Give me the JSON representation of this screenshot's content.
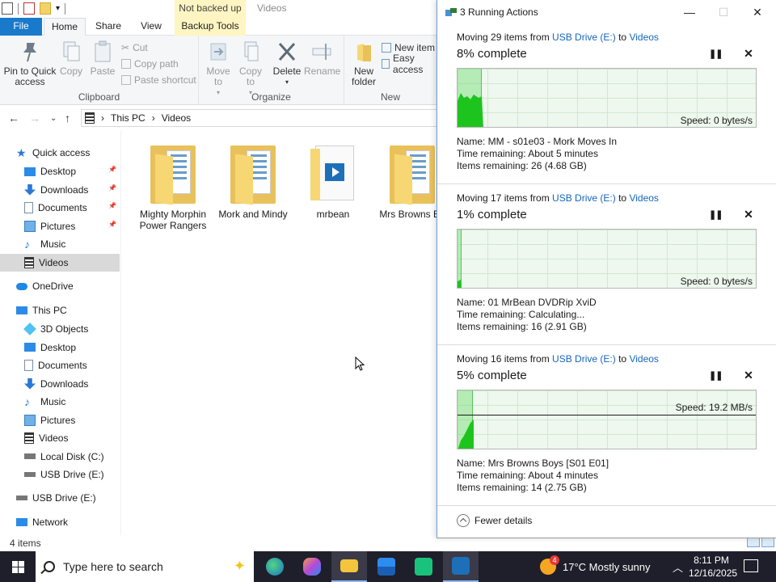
{
  "explorer": {
    "backup_context_header": "Not backed up",
    "folder_title": "Videos",
    "tabs": {
      "file": "File",
      "home": "Home",
      "share": "Share",
      "view": "View",
      "backup": "Backup Tools"
    },
    "ribbon": {
      "pin": "Pin to Quick access",
      "copy": "Copy",
      "paste": "Paste",
      "cut": "Cut",
      "copy_path": "Copy path",
      "paste_shortcut": "Paste shortcut",
      "clipboard_group": "Clipboard",
      "move_to": "Move to",
      "copy_to": "Copy to",
      "delete": "Delete",
      "rename": "Rename",
      "organize_group": "Organize",
      "new_folder": "New folder",
      "new_item": "New item",
      "easy_access": "Easy access",
      "new_group": "New"
    },
    "address": {
      "crumb1": "This PC",
      "crumb2": "Videos"
    },
    "nav": {
      "quick_access": "Quick access",
      "qa_items": [
        "Desktop",
        "Downloads",
        "Documents",
        "Pictures",
        "Music",
        "Videos"
      ],
      "onedrive": "OneDrive",
      "this_pc": "This PC",
      "pc_items": [
        "3D Objects",
        "Desktop",
        "Documents",
        "Downloads",
        "Music",
        "Pictures",
        "Videos",
        "Local Disk (C:)",
        "USB Drive (E:)"
      ],
      "usb_drive": "USB Drive (E:)",
      "network": "Network"
    },
    "files": [
      {
        "name": "Mighty Morphin Power Rangers",
        "icon": "folder-icon"
      },
      {
        "name": "Mork and Mindy",
        "icon": "folder-icon"
      },
      {
        "name": "mrbean",
        "icon": "video-folder-icon"
      },
      {
        "name": "Mrs Browns Bo",
        "icon": "folder-icon"
      }
    ],
    "status": "4 items"
  },
  "dialog": {
    "title": "3 Running Actions",
    "operations": [
      {
        "prefix": "Moving 29 items from",
        "from": "USB Drive (E:)",
        "to_word": "to",
        "to": "Videos",
        "percent_text": "8% complete",
        "progress": 0.08,
        "speed": "Speed: 0 bytes/s",
        "name": "Name:  MM - s01e03 - Mork Moves In",
        "time": "Time remaining:  About 5 minutes",
        "items": "Items remaining:  26 (4.68 GB)"
      },
      {
        "prefix": "Moving 17 items from",
        "from": "USB Drive (E:)",
        "to_word": "to",
        "to": "Videos",
        "percent_text": "1% complete",
        "progress": 0.01,
        "speed": "Speed: 0 bytes/s",
        "name": "Name:  01 MrBean DVDRip XviD",
        "time": "Time remaining:  Calculating...",
        "items": "Items remaining:  16 (2.91 GB)"
      },
      {
        "prefix": "Moving 16 items from",
        "from": "USB Drive (E:)",
        "to_word": "to",
        "to": "Videos",
        "percent_text": "5% complete",
        "progress": 0.05,
        "speed": "Speed: 19.2 MB/s",
        "name": "Name:  Mrs Browns Boys [S01 E01]",
        "time": "Time remaining:  About 4 minutes",
        "items": "Items remaining:  14 (2.75 GB)"
      }
    ],
    "fewer_details": "Fewer details"
  },
  "taskbar": {
    "search_placeholder": "Type here to search",
    "weather": "17°C  Mostly sunny",
    "weather_badge": "4",
    "time": "8:11 PM",
    "date": "12/16/2025"
  },
  "colors": {
    "accent": "#1979ca",
    "link": "#1565c0",
    "graph_fill": "#5cc05c",
    "taskbar": "#1f1f2b"
  }
}
